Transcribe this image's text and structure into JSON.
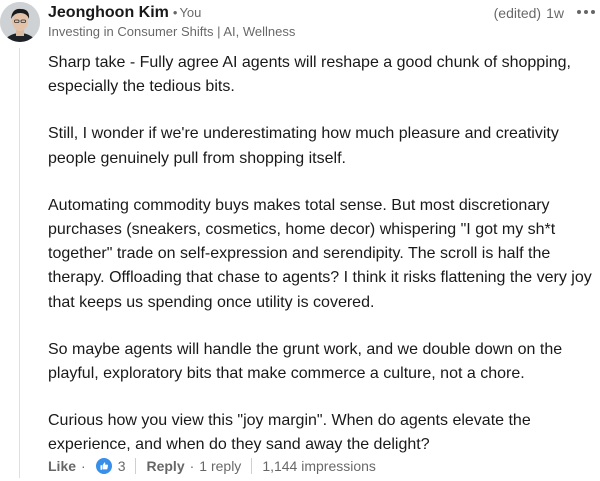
{
  "author": {
    "name": "Jeonghoon Kim",
    "relation": "You",
    "headline": "Investing in Consumer Shifts | AI, Wellness"
  },
  "meta": {
    "edited": "(edited)",
    "time": "1w"
  },
  "comment": {
    "paragraphs": [
      "Sharp take - Fully agree AI agents will reshape a good chunk of shopping, especially the tedious bits.",
      "Still, I wonder if we're underestimating how much pleasure and creativity people genuinely pull from shopping itself.",
      "Automating commodity buys makes total sense. But most discretionary purchases (sneakers, cosmetics, home decor) whispering \"I got my sh*t together\" trade on self-expression and serendipity. The scroll is half the therapy. Offloading that chase to agents? I think it risks flattening the very joy that keeps us spending once utility is covered.",
      "So maybe agents will handle the grunt work, and we double down on the playful, exploratory bits that make commerce a culture, not a chore.",
      "Curious how you view this \"joy margin\". When do agents elevate the experience, and when do they sand away the delight?"
    ]
  },
  "actions": {
    "like_label": "Like",
    "reaction_count": "3",
    "reply_label": "Reply",
    "reply_count": "1 reply",
    "impressions": "1,144 impressions"
  },
  "colors": {
    "like_blue": "#378fe9",
    "thread_line": "#e0dfdc"
  }
}
